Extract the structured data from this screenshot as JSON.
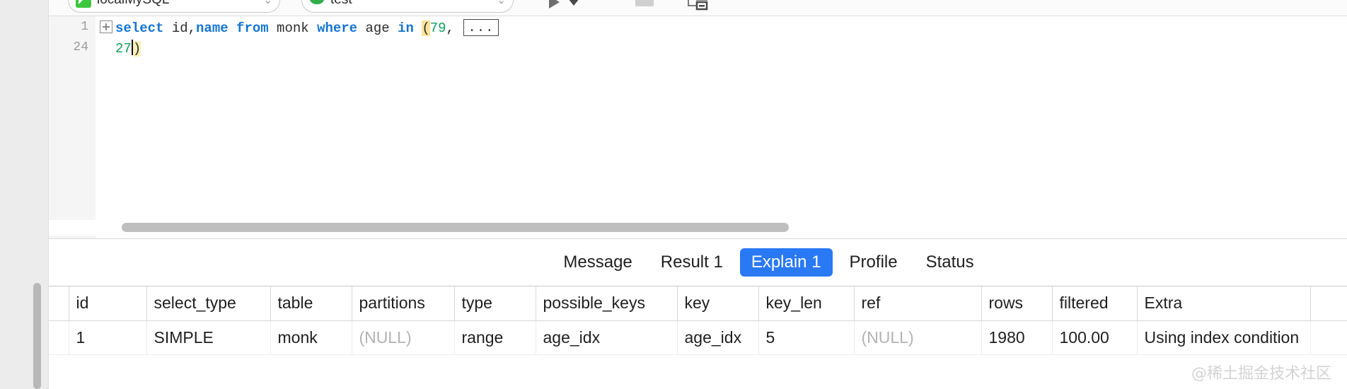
{
  "toolbar": {
    "connection": {
      "label": "localMySQL",
      "icon": "mysql-icon",
      "chevron": "⌄"
    },
    "database": {
      "label": "test",
      "icon": "database-icon",
      "chevron": "⌄"
    },
    "run_button_name": "run-query-button",
    "run_dropdown_name": "run-options-dropdown",
    "stop_button_name": "stop-query-button",
    "explain_button_name": "explain-plan-button"
  },
  "editor": {
    "line_numbers": [
      "1",
      "24"
    ],
    "fold_marker": "+",
    "fold_ellipsis": "...",
    "line1": {
      "kw_select": "select",
      "cols": " id,",
      "kw_name": "name",
      "space1": " ",
      "kw_from": "from",
      "table": " monk ",
      "kw_where": "where",
      "field": " age ",
      "kw_in": "in",
      "space2": " ",
      "open_paren": "(",
      "first_value": "79",
      "comma": ", "
    },
    "line2": {
      "last_value": "27",
      "close_paren": ")"
    }
  },
  "result_tabs": [
    {
      "label": "Message",
      "active": false
    },
    {
      "label": "Result 1",
      "active": false
    },
    {
      "label": "Explain 1",
      "active": true
    },
    {
      "label": "Profile",
      "active": false
    },
    {
      "label": "Status",
      "active": false
    }
  ],
  "explain_grid": {
    "columns": [
      "id",
      "select_type",
      "table",
      "partitions",
      "type",
      "possible_keys",
      "key",
      "key_len",
      "ref",
      "rows",
      "filtered",
      "Extra"
    ],
    "rows": [
      {
        "id": "1",
        "select_type": "SIMPLE",
        "table": "monk",
        "partitions": "(NULL)",
        "type": "range",
        "possible_keys": "age_idx",
        "key": "age_idx",
        "key_len": "5",
        "ref": "(NULL)",
        "rows": "1980",
        "filtered": "100.00",
        "Extra": "Using index condition"
      }
    ]
  },
  "watermark": "@稀土掘金技术社区",
  "colors": {
    "accent_blue": "#2979f5",
    "keyword_blue": "#1675d1",
    "number_green": "#12a05c",
    "highlight_yellow": "#fbe49b",
    "null_gray": "#b3b3b3",
    "rail_gray": "#ececec"
  }
}
